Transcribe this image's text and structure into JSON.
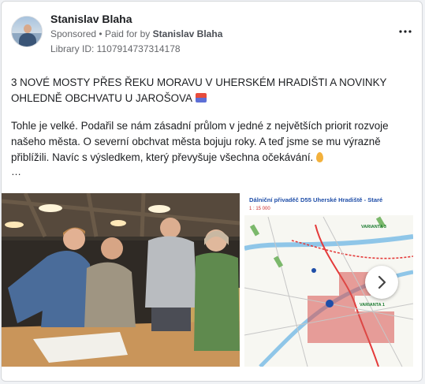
{
  "ad": {
    "page_name": "Stanislav Blaha",
    "sponsored_label": "Sponsored",
    "paid_for_label": "Paid for by",
    "paid_for_name": "Stanislav Blaha",
    "library_id": "Library ID: 1107914737314178",
    "title": "3 NOVÉ MOSTY PŘES ŘEKU MORAVU V UHERSKÉM HRADIŠTI A NOVINKY OHLEDNĚ OBCHVATU U JAROŠOVA",
    "body": "Tohle je velké. Podařil se nám zásadní průlom v jedné z největších priorit rozvoje našeho města. O severní obchvat města bojuju roky. A teď jsme se mu výrazně přiblížili. Navíc s výsledkem, který převyšuje všechna očekávání.",
    "truncation": "…"
  },
  "carousel": {
    "map_title": "Dálniční přivaděč D55 Uherské Hradiště - Staré",
    "map_scale": "1 : 15 000",
    "map_label_1": "VARIANTA 1",
    "map_label_2": "VARIANTA 3"
  },
  "icons": {
    "more": "more-horizontal-icon",
    "next": "chevron-right-icon"
  }
}
